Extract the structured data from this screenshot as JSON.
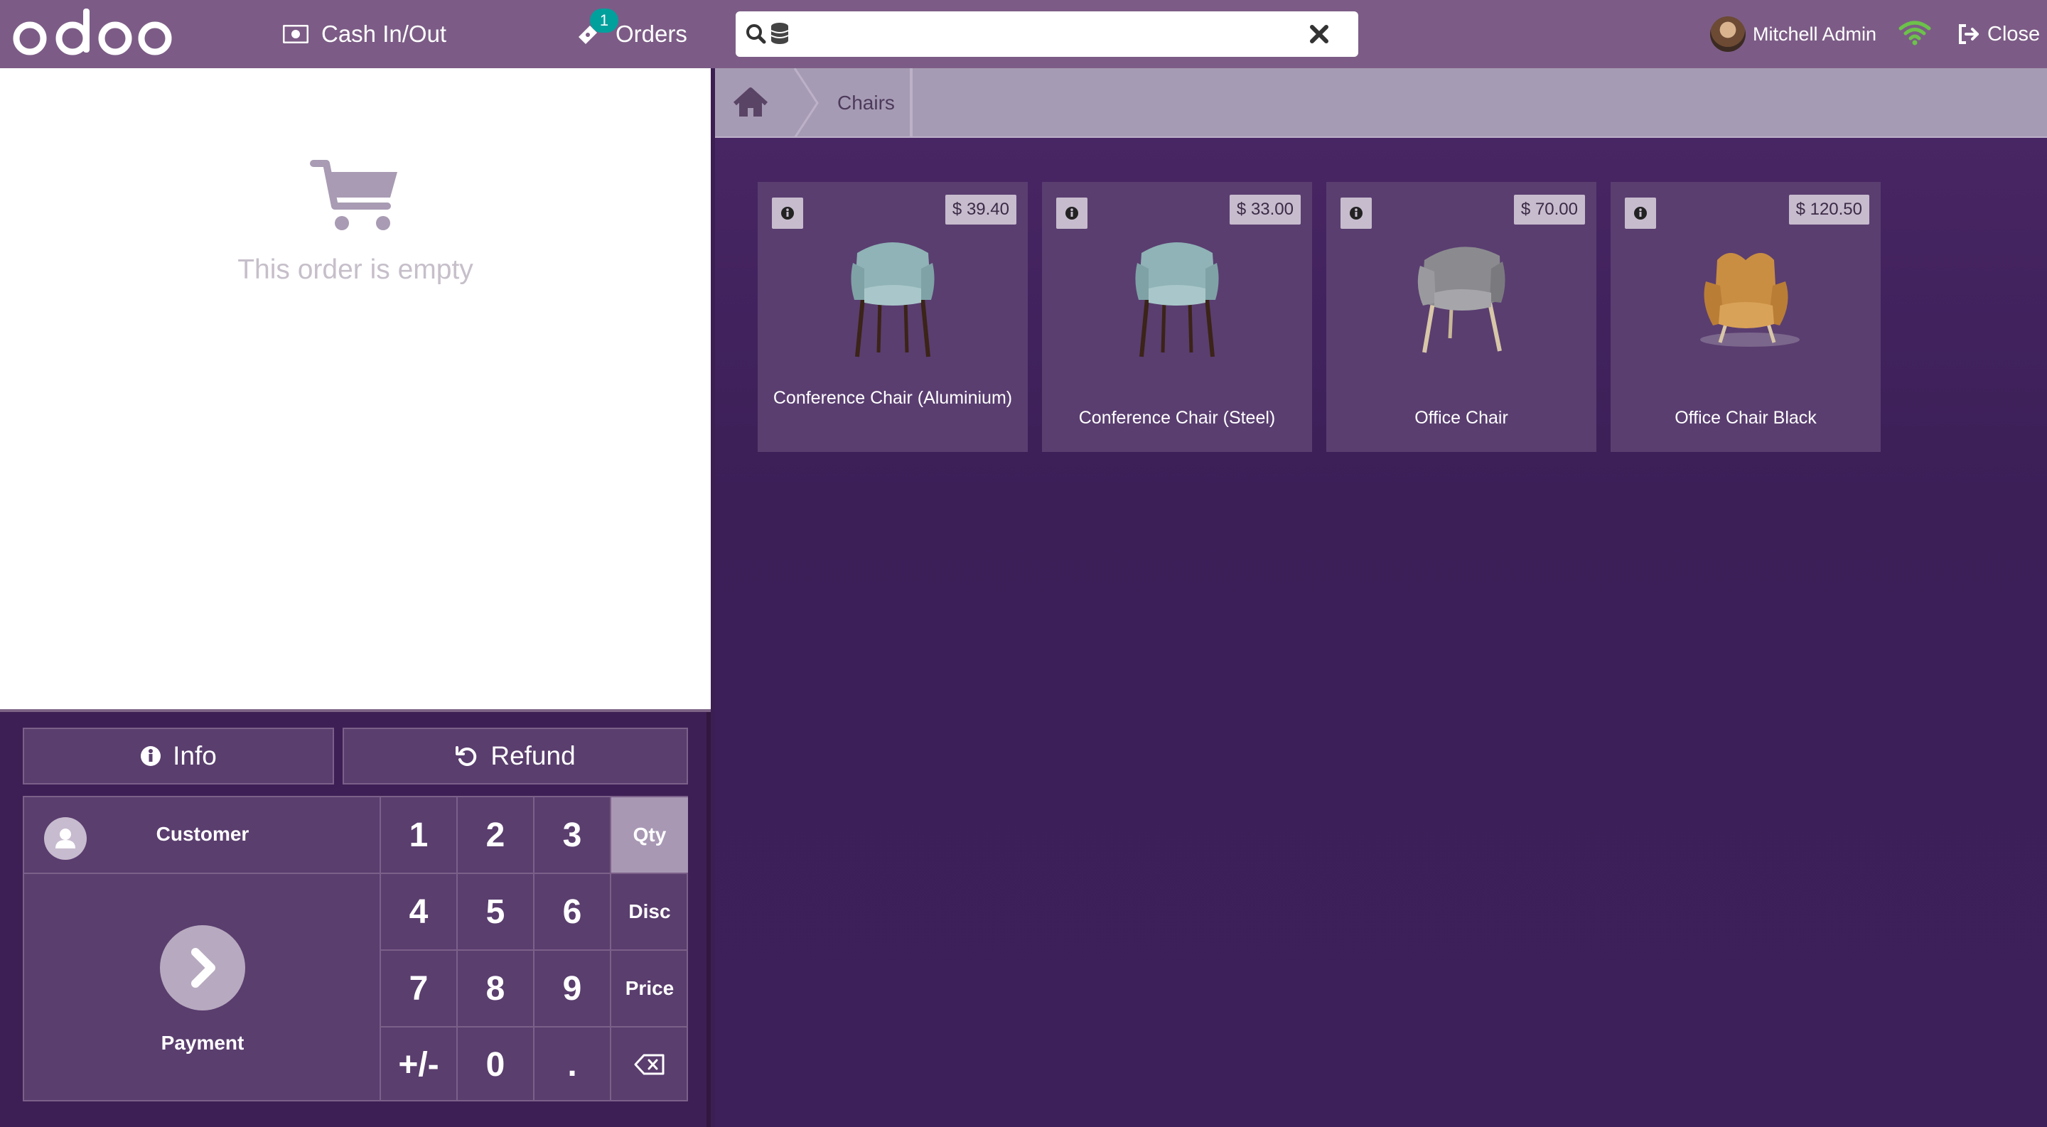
{
  "topbar": {
    "logo": "odoo",
    "cash_label": "Cash In/Out",
    "orders_label": "Orders",
    "orders_badge": "1",
    "search_value": "",
    "search_placeholder": "",
    "user_name": "Mitchell Admin",
    "close_label": "Close"
  },
  "order": {
    "empty_message": "This order is empty"
  },
  "controls": {
    "info_label": "Info",
    "refund_label": "Refund",
    "customer_label": "Customer",
    "payment_label": "Payment"
  },
  "numpad": {
    "keys": [
      "1",
      "2",
      "3",
      "4",
      "5",
      "6",
      "7",
      "8",
      "9",
      "+/-",
      "0",
      "."
    ],
    "modes": [
      "Qty",
      "Disc",
      "Price"
    ],
    "active_mode": "Qty"
  },
  "breadcrumb": {
    "category": "Chairs"
  },
  "products": [
    {
      "name": "Conference Chair (Aluminium)",
      "price": "$ 39.40"
    },
    {
      "name": "Conference Chair (Steel)",
      "price": "$ 33.00"
    },
    {
      "name": "Office Chair",
      "price": "$ 70.00"
    },
    {
      "name": "Office Chair Black",
      "price": "$ 120.50"
    }
  ],
  "colors": {
    "topbar": "#7c5c86",
    "accent_badge": "#00a09d",
    "pane": "#3e1f55",
    "wifi": "#6cc24a"
  }
}
